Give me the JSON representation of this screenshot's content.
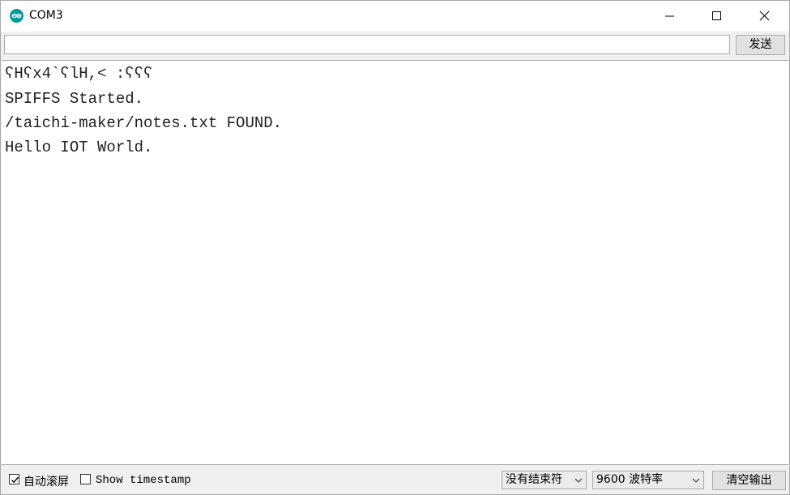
{
  "window": {
    "title": "COM3"
  },
  "send": {
    "input_value": "",
    "button_label": "发送"
  },
  "output": {
    "lines": [
      "ʕHʕx4`ʕlH,< :ʕʕʕ",
      "SPIFFS Started.",
      "/taichi-maker/notes.txt FOUND.",
      "Hello IOT World."
    ]
  },
  "bottom": {
    "autoscroll_label": "自动滚屏",
    "autoscroll_checked": true,
    "timestamp_label": "Show timestamp",
    "timestamp_checked": false,
    "line_ending_selected": "没有结束符",
    "baud_selected": "9600 波特率",
    "clear_label": "清空输出"
  },
  "colors": {
    "accent": "#00979c",
    "titlebar_bg": "#ffffff",
    "chrome_bg": "#f0f0f0",
    "output_bg": "#ffffff",
    "button_bg": "#e1e1e1"
  }
}
